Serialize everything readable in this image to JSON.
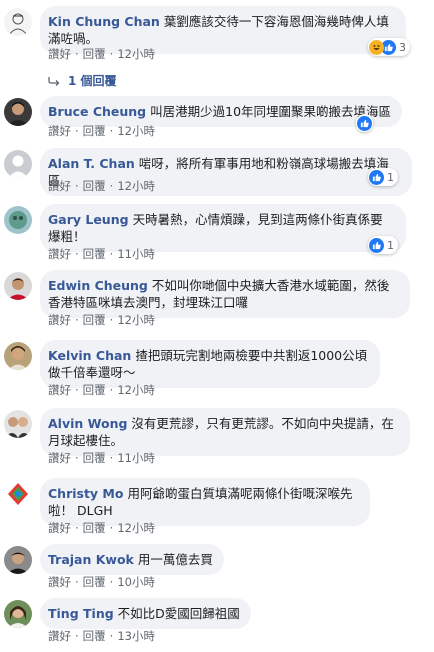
{
  "actions": {
    "like": "讚好",
    "reply": "回覆"
  },
  "comments": [
    {
      "author": "Kin Chung Chan",
      "text": "葉劉應該交待一下容海恩個海幾時俾人填滿咗喎。",
      "time": "12小時",
      "reactions": {
        "types": [
          "haha-icon",
          "like-icon"
        ],
        "count": "3"
      }
    },
    {
      "author": "Bruce Cheung",
      "text": "叫居港期少過10年同埋圍聚果啲搬去填海區",
      "time": "12小時",
      "reactions": {
        "types": [
          "like-icon"
        ],
        "count": ""
      }
    },
    {
      "author": "Alan T. Chan",
      "text": "啱呀，將所有軍事用地和粉嶺高球場搬去填海區",
      "time": "12小時",
      "reactions": {
        "types": [
          "like-icon"
        ],
        "count": "1"
      }
    },
    {
      "author": "Gary Leung",
      "text": "天時暑熱，心情煩躁，見到這两條仆街真係要爆粗！",
      "time": "11小時",
      "reactions": {
        "types": [
          "like-icon"
        ],
        "count": "1"
      }
    },
    {
      "author": "Edwin Cheung",
      "text": "不如叫你哋個中央擴大香港水域範圍，然後香港特區咪填去澳門，封埋珠江口囉",
      "time": "12小時",
      "reactions": null
    },
    {
      "author": "Kelvin Chan",
      "text": "揸把頭玩完割地兩檢要中共割返1000公頃做千倍奉還呀～",
      "time": "12小時",
      "reactions": null
    },
    {
      "author": "Alvin Wong",
      "text": "沒有更荒謬，只有更荒謬。不如向中央提請，在月球起樓住。",
      "time": "11小時",
      "reactions": null
    },
    {
      "author": "Christy Mo",
      "text": "用阿爺啲蛋白質填滿呢兩條仆街嘅深喉先啦！ DLGH",
      "time": "12小時",
      "reactions": null
    },
    {
      "author": "Trajan Kwok",
      "text": "用一萬億去買",
      "time": "10小時",
      "reactions": null
    },
    {
      "author": "Ting Ting",
      "text": "不如比D愛國回歸祖國",
      "time": "13小時",
      "reactions": null
    }
  ],
  "reply_link": "1 個回覆"
}
